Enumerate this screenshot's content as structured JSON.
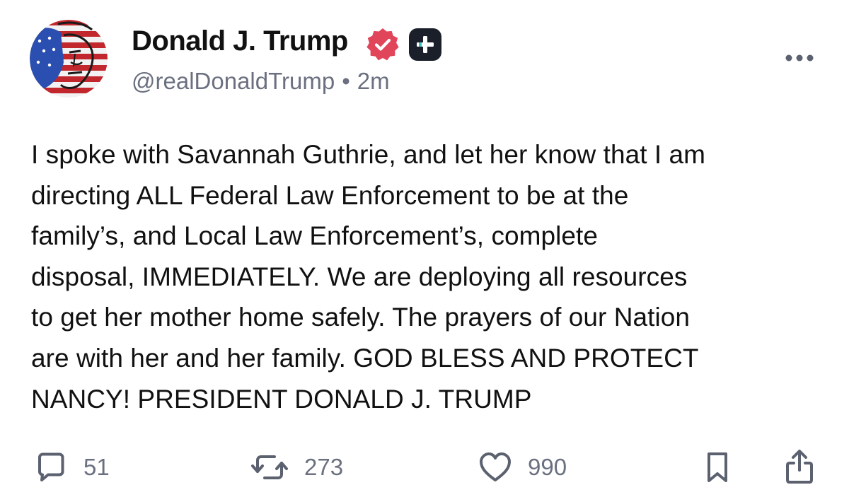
{
  "author": {
    "display_name": "Donald J. Trump",
    "handle": "@realDonaldTrump",
    "separator": "•",
    "timestamp": "2m",
    "avatar_icon": "flag-painted-portrait-avatar",
    "verified_icon": "verified-badge-icon",
    "plus_icon": "plus-square-icon",
    "verified_color": "#e0455a"
  },
  "post": {
    "text": "I spoke with Savannah Guthrie, and let her know that I am\ndirecting ALL Federal Law Enforcement to be at the\nfamily’s, and Local Law Enforcement’s, complete\ndisposal, IMMEDIATELY. We are deploying all resources\nto get her mother home safely. The prayers of our Nation\nare with her and her family. GOD BLESS AND PROTECT\nNANCY! PRESIDENT DONALD J. TRUMP"
  },
  "menu": {
    "icon": "more-horizontal-icon"
  },
  "actions": {
    "replies": {
      "icon": "comment-bubble-icon",
      "count": "51"
    },
    "reposts": {
      "icon": "repost-icon",
      "count": "273"
    },
    "likes": {
      "icon": "heart-icon",
      "count": "990"
    },
    "bookmark": {
      "icon": "bookmark-icon"
    },
    "share": {
      "icon": "share-icon"
    }
  },
  "colors": {
    "text": "#111111",
    "muted": "#6b7080",
    "icon": "#5c6170",
    "verified": "#e0455a",
    "plus_badge": "#1b1f2a"
  }
}
